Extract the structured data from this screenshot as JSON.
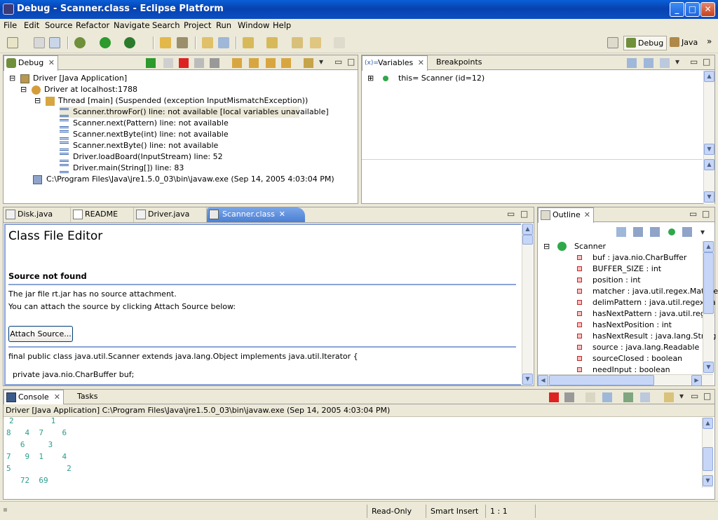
{
  "window": {
    "title": "Debug - Scanner.class - Eclipse Platform",
    "controls": {
      "minimize": "_",
      "maximize": "□",
      "close": "✕"
    }
  },
  "menu": [
    "File",
    "Edit",
    "Source",
    "Refactor",
    "Navigate",
    "Search",
    "Project",
    "Run",
    "Window",
    "Help"
  ],
  "perspectives": {
    "debug": "Debug",
    "java": "Java"
  },
  "debug_view": {
    "tab": "Debug",
    "tree": [
      {
        "text": "Driver [Java Application]"
      },
      {
        "text": "Driver at localhost:1788"
      },
      {
        "text": "Thread [main] (Suspended (exception InputMismatchException))"
      },
      {
        "text": "Scanner.throwFor() line: not available [local variables unavailable]"
      },
      {
        "text": "Scanner.next(Pattern) line: not available"
      },
      {
        "text": "Scanner.nextByte(int) line: not available"
      },
      {
        "text": "Scanner.nextByte() line: not available"
      },
      {
        "text": "Driver.loadBoard(InputStream) line: 52"
      },
      {
        "text": "Driver.main(String[]) line: 83"
      },
      {
        "text": "C:\\Program Files\\Java\\jre1.5.0_03\\bin\\javaw.exe (Sep 14, 2005 4:03:04 PM)"
      }
    ]
  },
  "variables_view": {
    "tab": "Variables",
    "tab2": "Breakpoints",
    "prefix": "(x)=",
    "rows": [
      {
        "text": "this= Scanner  (id=12)"
      }
    ]
  },
  "editor": {
    "tabs": [
      "Disk.java",
      "README",
      "Driver.java",
      "Scanner.class"
    ],
    "heading": "Class File Editor",
    "subheading": "Source not found",
    "line1": "The jar file rt.jar has no source attachment.",
    "line2": "You can attach the source by clicking Attach Source below:",
    "button": "Attach Source...",
    "code1": "final public class java.util.Scanner extends java.lang.Object implements java.util.Iterator {",
    "code2": "private java.nio.CharBuffer buf;"
  },
  "outline_view": {
    "tab": "Outline",
    "class_name": "Scanner",
    "fields": [
      "buf : java.nio.CharBuffer",
      "BUFFER_SIZE : int",
      "position : int",
      "matcher : java.util.regex.Matche",
      "delimPattern : java.util.regex.Pa",
      "hasNextPattern : java.util.regex",
      "hasNextPosition : int",
      "hasNextResult : java.lang.String",
      "source : java.lang.Readable",
      "sourceClosed : boolean",
      "needInput : boolean"
    ]
  },
  "console_view": {
    "tab": "Console",
    "tab2": "Tasks",
    "header": "Driver [Java Application] C:\\Program Files\\Java\\jre1.5.0_03\\bin\\javaw.exe (Sep 14, 2005 4:03:04 PM)",
    "lines": [
      "2        1",
      "8   4  7    6",
      "   6     3",
      "7   9  1    4",
      "5            2",
      "   72  69"
    ]
  },
  "statusbar": {
    "mode": "Read-Only",
    "insert": "Smart Insert",
    "position": "1 : 1"
  },
  "colors": {
    "title_blue": "#0a4ec2",
    "console_text": "#2a9d8f",
    "selection_tab": "#4b7fd4"
  }
}
